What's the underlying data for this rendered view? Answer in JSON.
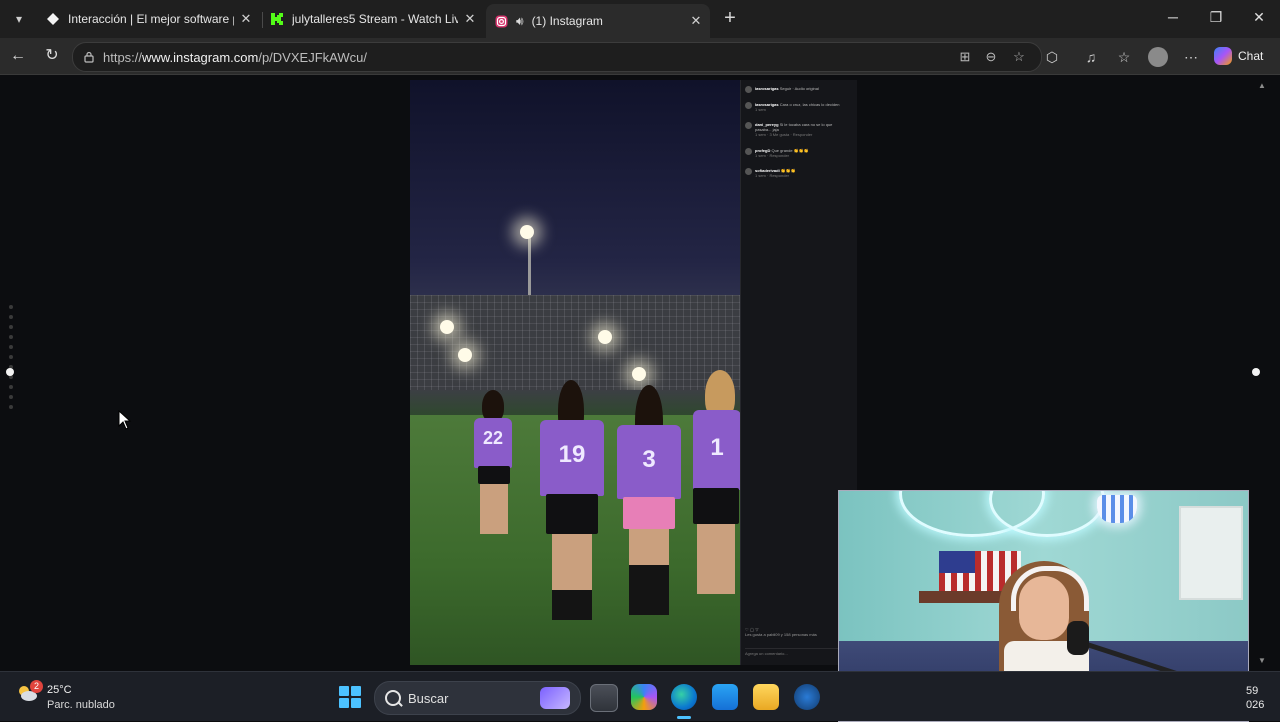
{
  "browser": {
    "tabs": [
      {
        "title": "Interacción | El mejor software par",
        "favicon": "diamond-icon"
      },
      {
        "title": "julytalleres5 Stream - Watch Live o",
        "favicon": "kick-icon"
      },
      {
        "title": "(1) Instagram",
        "favicon": "instagram-icon",
        "audio": "speaker-icon"
      }
    ],
    "url_prefix": "https://",
    "url_host": "www.instagram.com",
    "url_path": "/p/DVXEJFkAWcu/",
    "chat_label": "Chat"
  },
  "post": {
    "comments": [
      {
        "user": "lasrosarigas",
        "text": "Seguir · Audio original",
        "meta": ""
      },
      {
        "user": "lasrosarigas",
        "text": "Cara o cruz, las chicas lo deciden",
        "meta": "1 sem"
      },
      {
        "user": "dani_pereyg",
        "text": "Si le tocaba cara no se lo que pasaba... jaja",
        "meta": "1 sem · 3 Me gusta · Responder"
      },
      {
        "user": "profegD",
        "text": "Que grande 👏👏👏",
        "meta": "1 sem · Responder"
      },
      {
        "user": "sofiaderivadi",
        "text": "👏👏👏",
        "meta": "1 sem · Responder"
      }
    ],
    "likes_line": "Les gusta a pabli09 y 158 personas más",
    "comment_placeholder": "Agrega un comentario..."
  },
  "taskbar": {
    "badge": "2",
    "temp": "25°C",
    "condition": "Parc. nublado",
    "search_label": "Buscar",
    "time": "59",
    "date": "026"
  },
  "colors": {
    "accent": "#4cc2ff",
    "jersey": "#8a5cc9"
  }
}
